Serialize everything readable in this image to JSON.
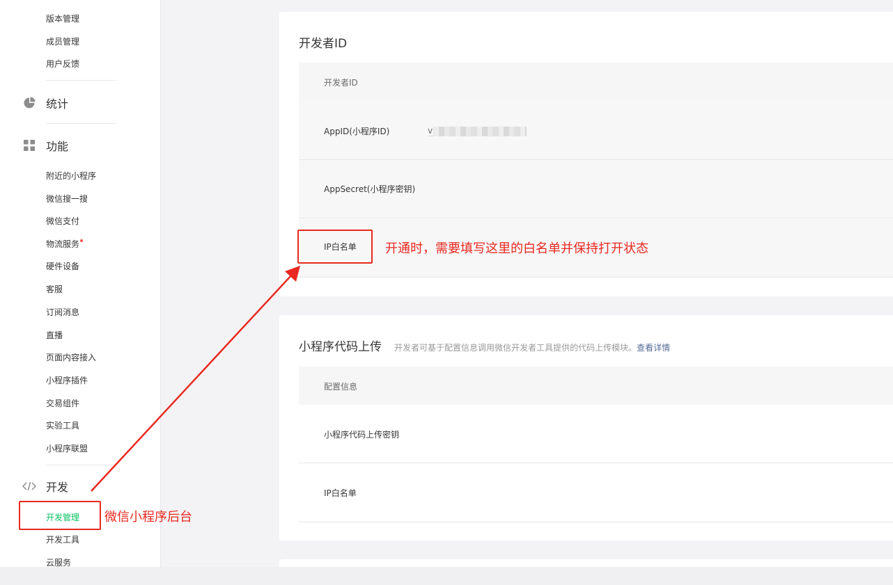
{
  "sidebar": {
    "top_items": [
      "版本管理",
      "成员管理",
      "用户反馈"
    ],
    "sections": {
      "stats": "统计",
      "features": "功能",
      "develop": "开发"
    },
    "feature_items": [
      "附近的小程序",
      "微信搜一搜",
      "微信支付",
      "物流服务",
      "硬件设备",
      "客服",
      "订阅消息",
      "直播",
      "页面内容接入",
      "小程序插件",
      "交易组件",
      "实验工具",
      "小程序联盟"
    ],
    "dev_items": [
      "开发管理",
      "开发工具",
      "云服务"
    ],
    "active_item": "开发管理",
    "accent_color": "#07c160",
    "badge_color": "#fa5151"
  },
  "developer_id_card": {
    "title": "开发者ID",
    "header_label": "开发者ID",
    "appid_label": "AppID(小程序ID)",
    "appid_value_visible": "v",
    "appsecret_label": "AppSecret(小程序密钥)",
    "ip_whitelist_label": "IP白名单"
  },
  "upload_card": {
    "title": "小程序代码上传",
    "description": "开发者可基于配置信息调用微信开发者工具提供的代码上传模块。",
    "link_text": "查看详情",
    "header_label": "配置信息",
    "secret_label": "小程序代码上传密钥",
    "ip_whitelist_label": "IP白名单"
  },
  "annotations": {
    "whitelist_note": "开通时，需要填写这里的白名单并保持打开状态",
    "backend_note": "微信小程序后台",
    "color": "#e8281f"
  }
}
